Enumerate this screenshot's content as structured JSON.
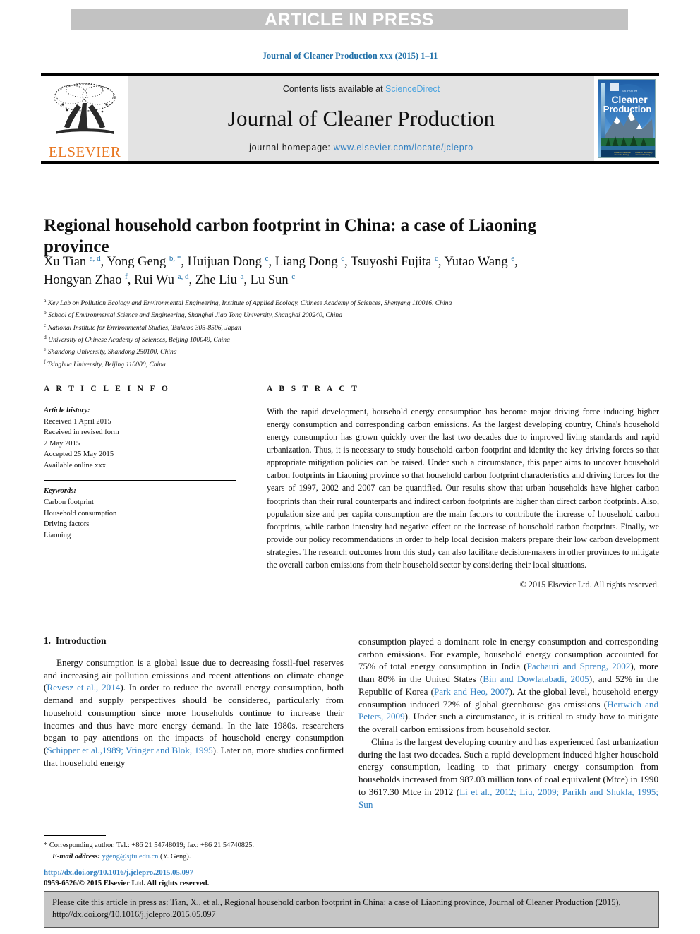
{
  "banner": {
    "text": "ARTICLE IN PRESS",
    "bg_color": "#c2c2c2",
    "text_color": "#ffffff"
  },
  "running_head": "Journal of Cleaner Production xxx (2015) 1–11",
  "masthead": {
    "publisher": "ELSEVIER",
    "publisher_color": "#e87722",
    "contents_prefix": "Contents lists available at ",
    "contents_link": "ScienceDirect",
    "journal_title": "Journal of Cleaner Production",
    "homepage_prefix": "journal homepage: ",
    "homepage_link": "www.elsevier.com/locate/jclepro",
    "link_color": "#2f7fc1",
    "cover_title_line1": "Cleaner",
    "cover_title_line2": "Production",
    "cover_kicker": "Journal of"
  },
  "article": {
    "title": "Regional household carbon footprint in China: a case of Liaoning province",
    "authors_line1": "Xu Tian <sup>a, d</sup>, Yong Geng <sup>b, *</sup>, Huijuan Dong <sup>c</sup>, Liang Dong <sup>c</sup>, Tsuyoshi Fujita <sup>c</sup>, Yutao Wang <sup>e</sup>,",
    "authors_line2": "Hongyan Zhao <sup>f</sup>, Rui Wu <sup>a, d</sup>, Zhe Liu <sup>a</sup>, Lu Sun <sup>c</sup>",
    "affiliations": [
      {
        "mark": "a",
        "text": "Key Lab on Pollution Ecology and Environmental Engineering, Institute of Applied Ecology, Chinese Academy of Sciences, Shenyang 110016, China"
      },
      {
        "mark": "b",
        "text": "School of Environmental Science and Engineering, Shanghai Jiao Tong University, Shanghai 200240, China"
      },
      {
        "mark": "c",
        "text": "National Institute for Environmental Studies, Tsukuba 305-8506, Japan"
      },
      {
        "mark": "d",
        "text": "University of Chinese Academy of Sciences, Beijing 100049, China"
      },
      {
        "mark": "e",
        "text": "Shandong University, Shandong 250100, China"
      },
      {
        "mark": "f",
        "text": "Tsinghua University, Beijing 110000, China"
      }
    ]
  },
  "article_info": {
    "heading": "A R T I C L E   I N F O",
    "history_label": "Article history:",
    "history": [
      "Received 1 April 2015",
      "Received in revised form",
      "2 May 2015",
      "Accepted 25 May 2015",
      "Available online xxx"
    ],
    "keywords_label": "Keywords:",
    "keywords": [
      "Carbon footprint",
      "Household consumption",
      "Driving factors",
      "Liaoning"
    ]
  },
  "abstract": {
    "heading": "A B S T R A C T",
    "body": "With the rapid development, household energy consumption has become major driving force inducing higher energy consumption and corresponding carbon emissions. As the largest developing country, China's household energy consumption has grown quickly over the last two decades due to improved living standards and rapid urbanization. Thus, it is necessary to study household carbon footprint and identity the key driving forces so that appropriate mitigation policies can be raised. Under such a circumstance, this paper aims to uncover household carbon footprints in Liaoning province so that household carbon footprint characteristics and driving forces for the years of 1997, 2002 and 2007 can be quantified. Our results show that urban households have higher carbon footprints than their rural counterparts and indirect carbon footprints are higher than direct carbon footprints. Also, population size and per capita consumption are the main factors to contribute the increase of household carbon footprints, while carbon intensity had negative effect on the increase of household carbon footprints. Finally, we provide our policy recommendations in order to help local decision makers prepare their low carbon development strategies. The research outcomes from this study can also facilitate decision-makers in other provinces to mitigate the overall carbon emissions from their household sector by considering their local situations.",
    "copyright": "© 2015 Elsevier Ltd. All rights reserved."
  },
  "body": {
    "section_number": "1.",
    "section_title": "Introduction",
    "left_paragraph_1_html": "Energy consumption is a global issue due to decreasing fossil-fuel reserves and increasing air pollution emissions and recent attentions on climate change (<span class=\"ref\">Revesz et al., 2014</span>). In order to reduce the overall energy consumption, both demand and supply perspectives should be considered, particularly from household consumption since more households continue to increase their incomes and thus have more energy demand. In the late 1980s, researchers began to pay attentions on the impacts of household energy consumption (<span class=\"ref\">Schipper et al.,1989; Vringer and Blok, 1995</span>). Later on, more studies confirmed that household energy",
    "right_paragraph_1_html": "consumption played a dominant role in energy consumption and corresponding carbon emissions. For example, household energy consumption accounted for 75% of total energy consumption in India (<span class=\"ref\">Pachauri and Spreng, 2002</span>), more than 80% in the United States (<span class=\"ref\">Bin and Dowlatabadi, 2005</span>), and 52% in the Republic of Korea (<span class=\"ref\">Park and Heo, 2007</span>). At the global level, household energy consumption induced 72% of global greenhouse gas emissions (<span class=\"ref\">Hertwich and Peters, 2009</span>). Under such a circumstance, it is critical to study how to mitigate the overall carbon emissions from household sector.",
    "right_paragraph_2_html": "China is the largest developing country and has experienced fast urbanization during the last two decades. Such a rapid development induced higher household energy consumption, leading to that primary energy consumption from households increased from 987.03 million tons of coal equivalent (Mtce) in 1990 to 3617.30 Mtce in 2012 (<span class=\"ref\">Li et al., 2012; Liu, 2009; Parikh and Shukla, 1995; Sun</span>"
  },
  "footnote": {
    "marker": "*",
    "corresponding": "Corresponding author. Tel.: +86 21 54748019; fax: +86 21 54740825.",
    "email_label": "E-mail address:",
    "email": "ygeng@sjtu.edu.cn",
    "email_owner": "(Y. Geng)."
  },
  "doi_block": {
    "doi_url": "http://dx.doi.org/10.1016/j.jclepro.2015.05.097",
    "issn_line": "0959-6526/© 2015 Elsevier Ltd. All rights reserved."
  },
  "cite_box": {
    "text": "Please cite this article in press as: Tian, X., et al., Regional household carbon footprint in China: a case of Liaoning province, Journal of Cleaner Production (2015), http://dx.doi.org/10.1016/j.jclepro.2015.05.097",
    "bg_color": "#c6c6c6"
  }
}
